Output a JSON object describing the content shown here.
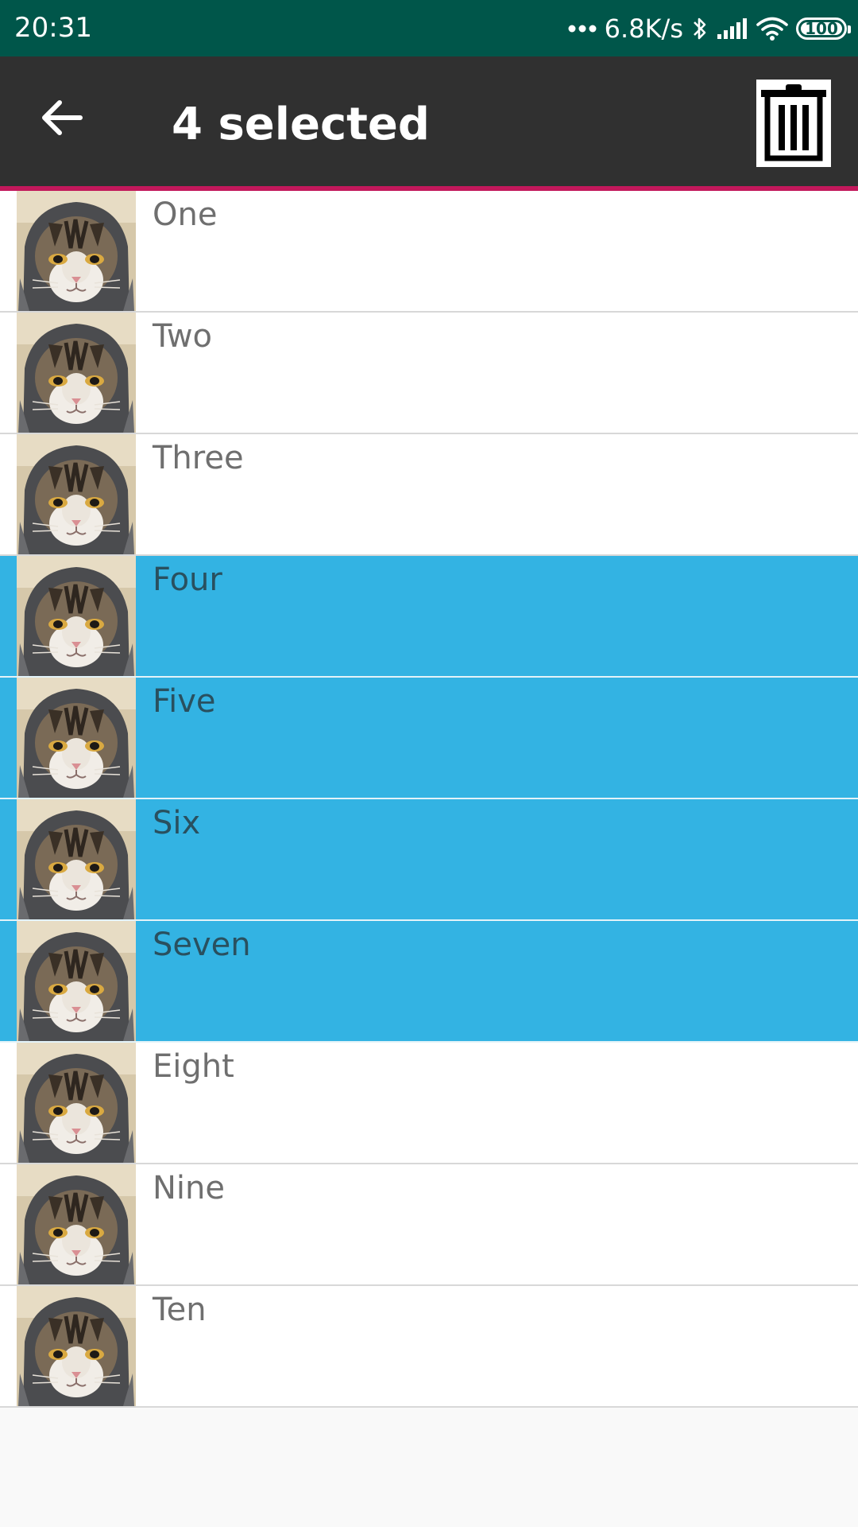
{
  "status_bar": {
    "time": "20:31",
    "network_speed": "6.8K/s",
    "battery_level": "100",
    "icons": [
      "more-dots-icon",
      "bluetooth-icon",
      "signal-icon",
      "wifi-icon",
      "battery-icon"
    ]
  },
  "app_bar": {
    "title": "4 selected",
    "back_icon": "arrow-left-icon",
    "delete_icon": "trash-icon",
    "background_color": "#303030",
    "accent_color": "#c2185b"
  },
  "list": {
    "selected_color": "#33b3e3",
    "items": [
      {
        "label": "One",
        "selected": false
      },
      {
        "label": "Two",
        "selected": false
      },
      {
        "label": "Three",
        "selected": false
      },
      {
        "label": "Four",
        "selected": true
      },
      {
        "label": "Five",
        "selected": true
      },
      {
        "label": "Six",
        "selected": true
      },
      {
        "label": "Seven",
        "selected": true
      },
      {
        "label": "Eight",
        "selected": false
      },
      {
        "label": "Nine",
        "selected": false
      },
      {
        "label": "Ten",
        "selected": false
      }
    ]
  }
}
